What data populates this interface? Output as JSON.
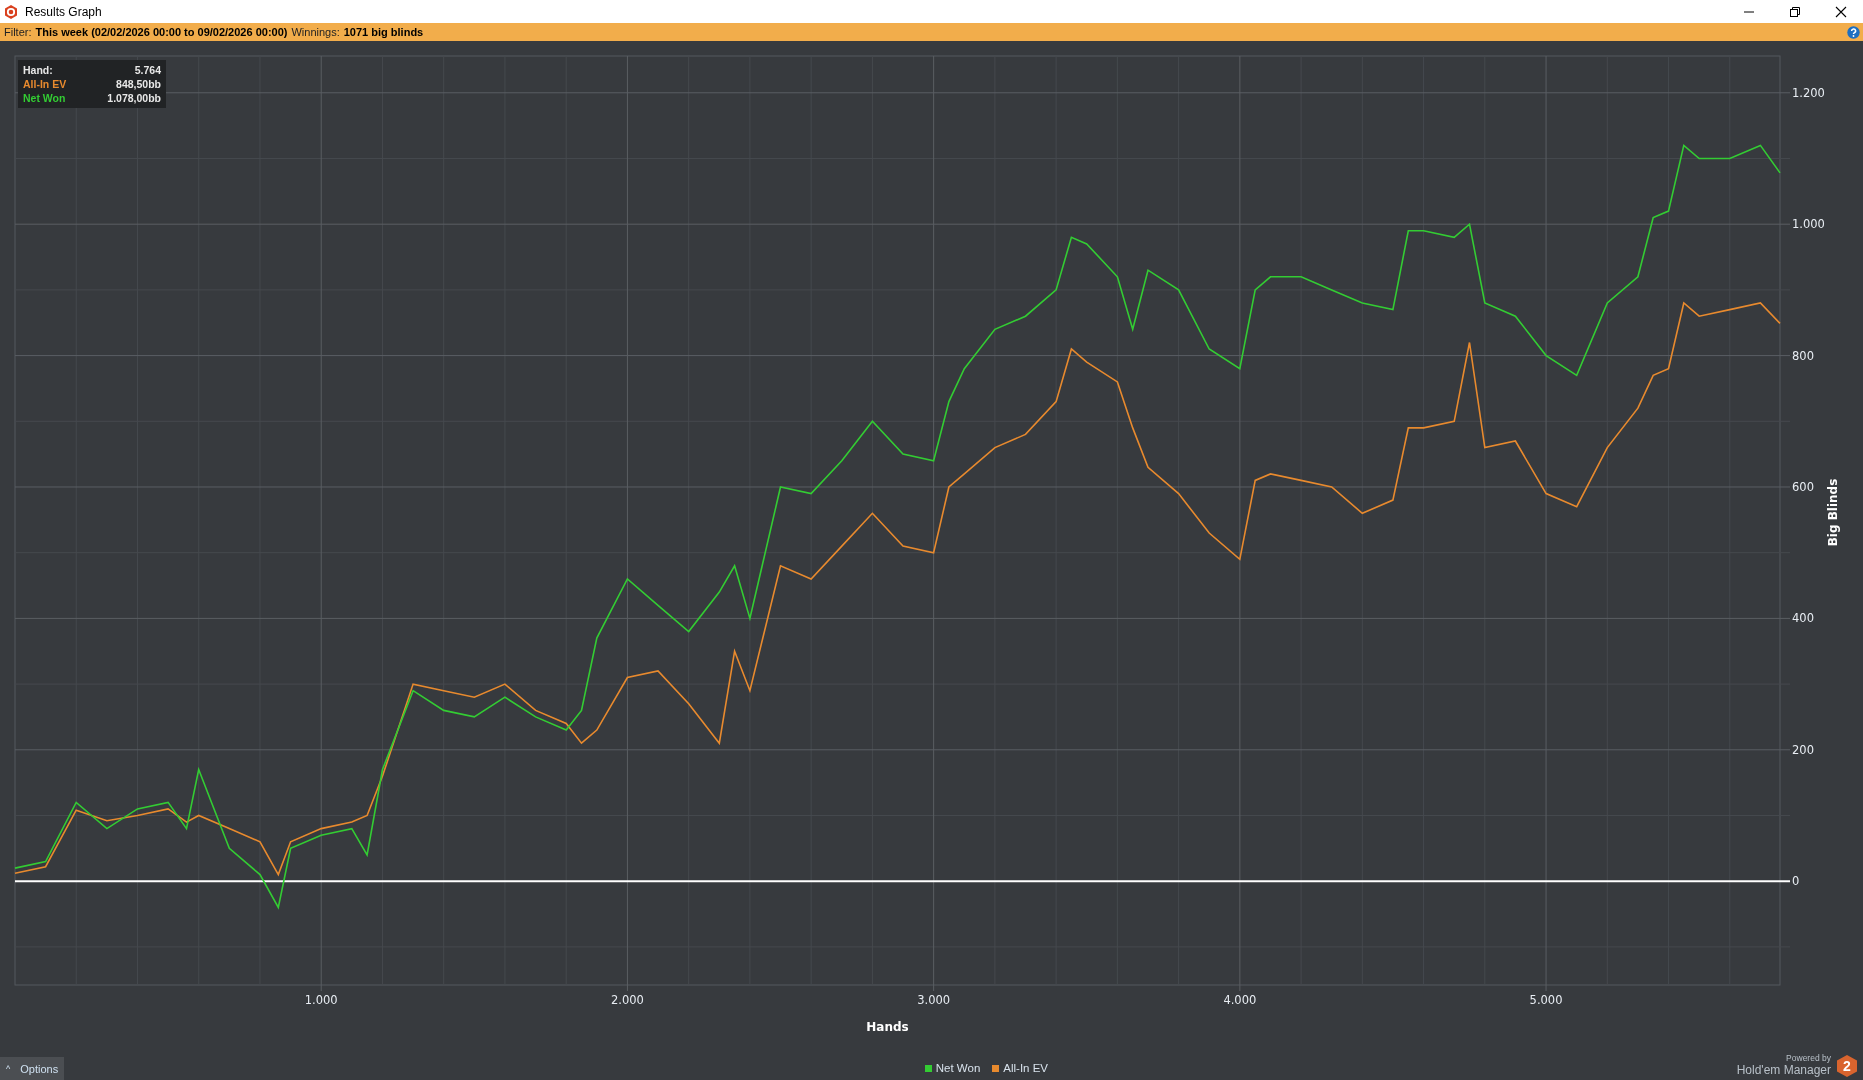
{
  "window": {
    "title": "Results Graph"
  },
  "filter_bar": {
    "filter_label": "Filter:",
    "filter_value": "This week (02/02/2026 00:00 to 09/02/2026 00:00)",
    "winnings_label": "Winnings:",
    "winnings_value": "1071 big blinds"
  },
  "tooltip": {
    "rows": [
      {
        "label": "Hand:",
        "value": "5.764"
      },
      {
        "label": "All-In EV",
        "value": "848,50bb"
      },
      {
        "label": "Net Won",
        "value": "1.078,00bb"
      }
    ]
  },
  "chart": {
    "chart_data": {
      "type": "line",
      "grid": true,
      "xlabel": "Hands",
      "ylabel": "Big Blinds",
      "xlim": [
        0,
        5764
      ],
      "ylim": [
        -158,
        1256
      ],
      "xticks": [
        {
          "value": 1000,
          "label": "1.000"
        },
        {
          "value": 2000,
          "label": "2.000"
        },
        {
          "value": 3000,
          "label": "3.000"
        },
        {
          "value": 4000,
          "label": "4.000"
        },
        {
          "value": 5000,
          "label": "5.000"
        }
      ],
      "yticks": [
        {
          "value": 0,
          "label": "0"
        },
        {
          "value": 200,
          "label": "200"
        },
        {
          "value": 400,
          "label": "400"
        },
        {
          "value": 600,
          "label": "600"
        },
        {
          "value": 800,
          "label": "800"
        },
        {
          "value": 1000,
          "label": "1.000"
        },
        {
          "value": 1200,
          "label": "1.200"
        }
      ],
      "x": [
        0,
        100,
        200,
        300,
        400,
        500,
        560,
        600,
        700,
        800,
        860,
        900,
        1000,
        1100,
        1150,
        1200,
        1300,
        1400,
        1500,
        1600,
        1700,
        1800,
        1850,
        1900,
        2000,
        2100,
        2200,
        2300,
        2350,
        2400,
        2500,
        2600,
        2700,
        2800,
        2900,
        3000,
        3050,
        3100,
        3200,
        3300,
        3400,
        3450,
        3500,
        3600,
        3650,
        3700,
        3800,
        3900,
        4000,
        4050,
        4100,
        4200,
        4300,
        4400,
        4500,
        4550,
        4600,
        4700,
        4750,
        4800,
        4900,
        5000,
        5100,
        5200,
        5300,
        5350,
        5400,
        5450,
        5500,
        5600,
        5700,
        5764
      ],
      "series": [
        {
          "name": "Net Won",
          "color": "#33cc33",
          "values": [
            20,
            30,
            120,
            80,
            110,
            120,
            80,
            170,
            50,
            10,
            -40,
            50,
            70,
            80,
            40,
            170,
            290,
            260,
            250,
            280,
            250,
            230,
            260,
            370,
            460,
            420,
            380,
            440,
            480,
            400,
            600,
            590,
            640,
            700,
            650,
            640,
            730,
            780,
            840,
            860,
            900,
            980,
            970,
            920,
            840,
            930,
            900,
            810,
            780,
            900,
            920,
            920,
            900,
            880,
            870,
            990,
            990,
            980,
            1000,
            880,
            860,
            800,
            770,
            880,
            920,
            1010,
            1020,
            1120,
            1100,
            1100,
            1120,
            1078
          ]
        },
        {
          "name": "All-In EV",
          "color": "#e88a2e",
          "values": [
            12,
            22,
            108,
            92,
            100,
            110,
            90,
            100,
            80,
            60,
            10,
            60,
            80,
            90,
            100,
            160,
            300,
            290,
            280,
            300,
            260,
            240,
            210,
            230,
            310,
            320,
            270,
            210,
            350,
            290,
            480,
            460,
            510,
            560,
            510,
            500,
            600,
            620,
            660,
            680,
            730,
            810,
            790,
            760,
            690,
            630,
            590,
            530,
            490,
            610,
            620,
            610,
            600,
            560,
            580,
            690,
            690,
            700,
            820,
            660,
            670,
            590,
            570,
            660,
            720,
            770,
            780,
            880,
            860,
            870,
            880,
            849
          ]
        }
      ]
    }
  },
  "footer": {
    "options_button": "Options",
    "options_icon": "^",
    "powered_by": "Powered by",
    "brand": "Hold'em Manager",
    "brand_badge": "2"
  }
}
